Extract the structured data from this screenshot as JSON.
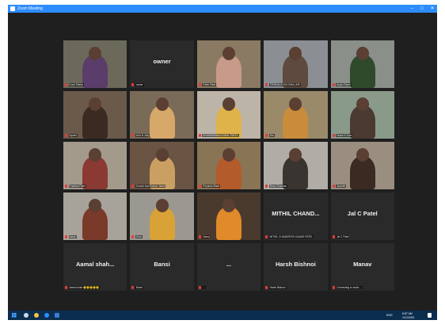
{
  "window": {
    "title": "Zoom Meeting",
    "controls": [
      "–",
      "□",
      "✕"
    ]
  },
  "participants": [
    {
      "label": "Kush Shelat",
      "big": "",
      "video": true,
      "active": true,
      "bg": "#6b6a5a",
      "fg": "#5a3d6b"
    },
    {
      "label": "owner",
      "big": "owner",
      "video": false
    },
    {
      "label": "Parth Patel",
      "big": "",
      "video": true,
      "bg": "#8a7a63",
      "fg": "#c79a8a"
    },
    {
      "label": "TIRNDALA MOUSMA UNE",
      "big": "",
      "video": true,
      "bg": "#8b8f93",
      "fg": "#5e4a3e"
    },
    {
      "label": "Aryan Ramit",
      "big": "",
      "video": true,
      "bg": "#8a8f8a",
      "fg": "#2f4a2a"
    },
    {
      "label": "Ayushi",
      "big": "",
      "video": true,
      "bg": "#6b5a4a",
      "fg": "#3b2a22"
    },
    {
      "label": "Aziz N Jolly",
      "big": "",
      "video": true,
      "bg": "#7a6a58",
      "fg": "#d6a86a"
    },
    {
      "label": "KRUSHNANAN KUNAL PATEL",
      "big": "",
      "video": true,
      "bg": "#bdb4a8",
      "fg": "#e0b24a"
    },
    {
      "label": "Sivi",
      "big": "",
      "video": true,
      "bg": "#9a8a6a",
      "fg": "#c98c3a"
    },
    {
      "label": "Grace K Jose",
      "big": "",
      "video": true,
      "bg": "#8a9a8a",
      "fg": "#4a3a32"
    },
    {
      "label": "Pradhan Patel",
      "big": "",
      "video": true,
      "bg": "#a39a8c",
      "fg": "#8a3a32"
    },
    {
      "label": "Suresh kant Kumar Jaiani",
      "big": "",
      "video": true,
      "bg": "#6a5444",
      "fg": "#caa062"
    },
    {
      "label": "Priyanka Bhatt",
      "big": "",
      "video": true,
      "bg": "#8a7456",
      "fg": "#b35b2a"
    },
    {
      "label": "Renu Chauhan",
      "big": "",
      "video": true,
      "bg": "#b0aca6",
      "fg": "#3a3430"
    },
    {
      "label": "Jeyanth",
      "big": "",
      "video": true,
      "bg": "#9a8e80",
      "fg": "#3a2a22"
    },
    {
      "label": "Aarav",
      "big": "",
      "video": true,
      "bg": "#a8a39a",
      "fg": "#7a3a2a"
    },
    {
      "label": "Arna",
      "big": "",
      "video": true,
      "bg": "#9a9890",
      "fg": "#d9a237"
    },
    {
      "label": "Nancy",
      "big": "",
      "video": true,
      "bg": "#4a3a2e",
      "fg": "#e08a2a"
    },
    {
      "label": "MITHIL CHANDRESH KUMAR PATEL",
      "big": "MITHIL CHAND...",
      "video": false
    },
    {
      "label": "Jal C Patel",
      "big": "Jal C Patel",
      "video": false
    },
    {
      "label": "Aamal shah 😊😊😊😊😊",
      "big": "Aamal shah...",
      "video": false
    },
    {
      "label": "Bansi",
      "big": "Bansi",
      "video": false
    },
    {
      "label": "...",
      "big": "...",
      "video": false
    },
    {
      "label": "Harsh Bishnoi",
      "big": "Harsh Bishnoi",
      "video": false
    },
    {
      "label": "Connecting to audio ...",
      "big": "Manav",
      "video": false
    }
  ],
  "taskbar": {
    "tray_text": "ENG",
    "time": "6:57 AM",
    "date": "1/12/2021"
  }
}
